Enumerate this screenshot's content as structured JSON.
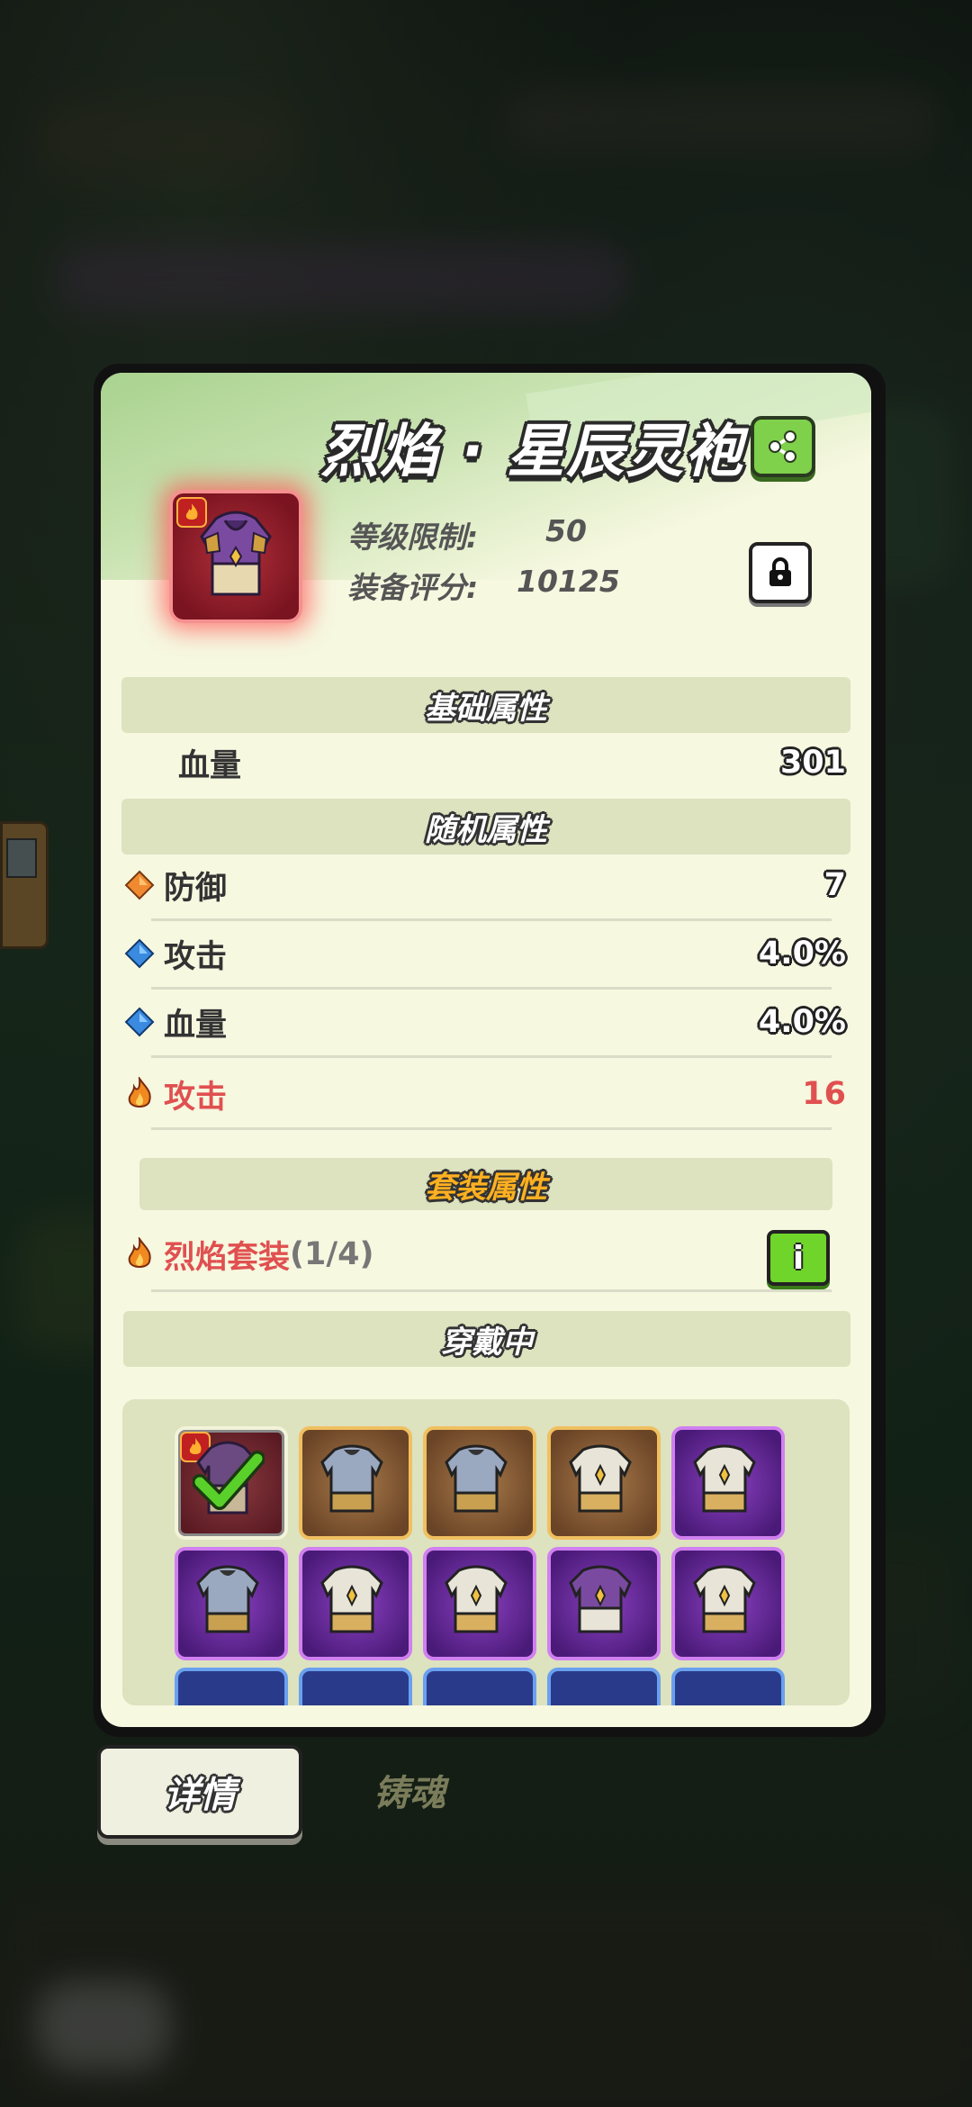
{
  "item": {
    "name": "烈焰 · 星辰灵袍",
    "level_label": "等级限制:",
    "level_value": "50",
    "score_label": "装备评分:",
    "score_value": "10125",
    "icon": "armor-robe-icon"
  },
  "base_attributes": {
    "header": "基础属性",
    "rows": [
      {
        "label": "血量",
        "value": "301"
      }
    ]
  },
  "random_attributes": {
    "header": "随机属性",
    "rows": [
      {
        "label": "防御",
        "value": "7",
        "icon": "orange-diamond-icon"
      },
      {
        "label": "攻击",
        "value": "4.0%",
        "icon": "blue-diamond-icon"
      },
      {
        "label": "血量",
        "value": "4.0%",
        "icon": "blue-diamond-icon"
      },
      {
        "label": "攻击",
        "value": "16",
        "icon": "flame-icon"
      }
    ]
  },
  "set_attributes": {
    "header": "套装属性",
    "set_name": "烈焰套装",
    "set_progress": "(1/4)",
    "info_label": "i"
  },
  "equipped": {
    "header": "穿戴中",
    "slots": [
      {
        "rarity": "red",
        "equipped": true
      },
      {
        "rarity": "gold"
      },
      {
        "rarity": "gold"
      },
      {
        "rarity": "gold"
      },
      {
        "rarity": "purple"
      },
      {
        "rarity": "purple"
      },
      {
        "rarity": "purple"
      },
      {
        "rarity": "purple"
      },
      {
        "rarity": "purple"
      },
      {
        "rarity": "purple"
      },
      {
        "rarity": "blue"
      },
      {
        "rarity": "blue"
      },
      {
        "rarity": "blue"
      },
      {
        "rarity": "blue"
      },
      {
        "rarity": "blue"
      }
    ]
  },
  "tabs": {
    "detail": "详情",
    "forge": "铸魂"
  },
  "colors": {
    "accent_green": "#7fd04a",
    "fire_red": "#e05050",
    "card_bg": "#f6f8e0"
  }
}
